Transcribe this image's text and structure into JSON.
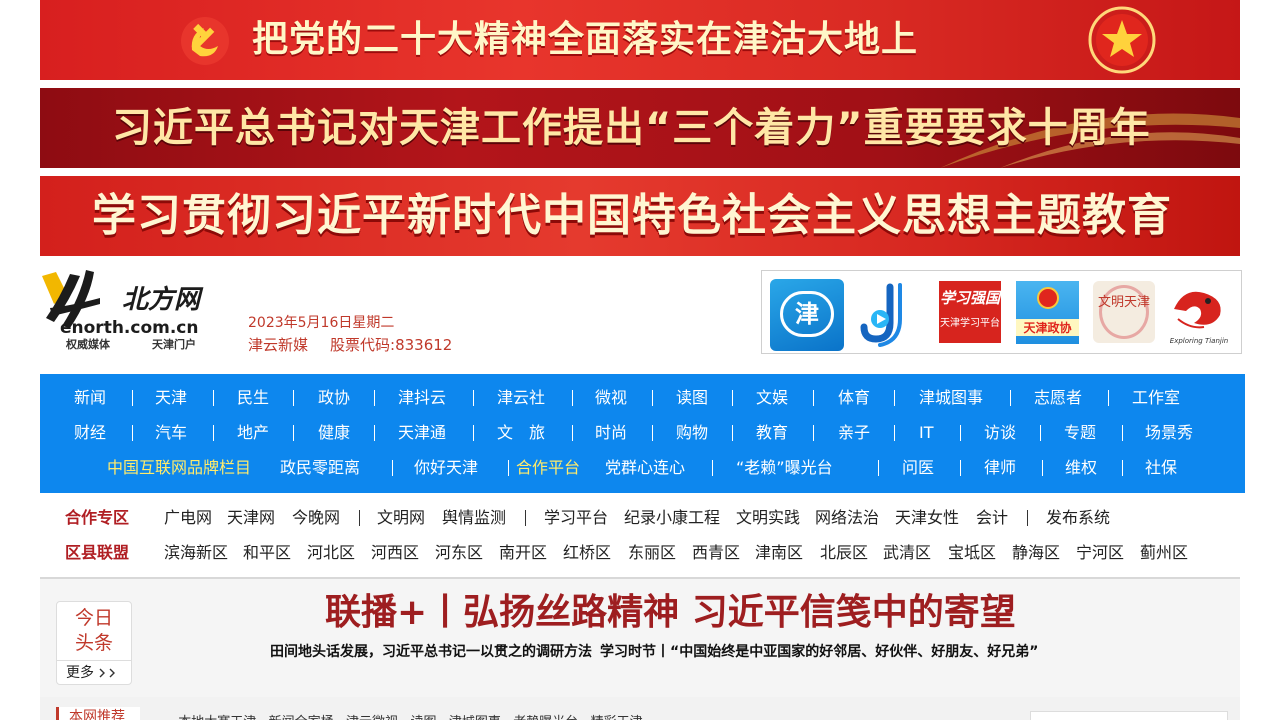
{
  "banners": [
    {
      "text": "把党的二十大精神全面落实在津沽大地上"
    },
    {
      "text": "习近平总书记对天津工作提出“三个着力”重要要求十周年"
    },
    {
      "text": "学习贯彻习近平新时代中国特色社会主义思想主题教育"
    }
  ],
  "header": {
    "logo_text": "北方网",
    "logo_domain": "enorth.com.cn",
    "logo_slogan_left": "权威媒体",
    "logo_slogan_right": "天津门户",
    "date": "2023年5月16日星期二",
    "media_name": "津云新媒",
    "stock_code": "股票代码:833612"
  },
  "apps": {
    "jin_glyph": "津",
    "xxqg_title": "学习强国",
    "xxqg_caption": "天津学习平台",
    "zhengxie_caption": "天津政协",
    "wenming_text": "文明天津",
    "explore_caption": "Exploring Tianjin"
  },
  "nav": {
    "row1": [
      "新闻",
      "天津",
      "民生",
      "政协",
      "津抖云",
      "津云社",
      "微视",
      "读图",
      "文娱",
      "体育",
      "津城图事",
      "志愿者",
      "工作室"
    ],
    "row2": [
      "财经",
      "汽车",
      "地产",
      "健康",
      "天津通",
      "文　旅",
      "时尚",
      "购物",
      "教育",
      "亲子",
      "IT",
      "访谈",
      "专题",
      "场景秀"
    ],
    "row3": [
      "中国互联网品牌栏目",
      "政民零距离",
      "你好天津",
      "合作平台",
      "党群心连心",
      "“老赖”曝光台",
      "问医",
      "律师",
      "维权",
      "社保"
    ]
  },
  "partners": {
    "title": "合作专区",
    "links": [
      "广电网",
      "天津网",
      "今晚网",
      "文明网",
      "舆情监测",
      "学习平台",
      "纪录小康工程",
      "文明实践",
      "网络法治",
      "天津女性",
      "会计",
      "发布系统"
    ]
  },
  "districts": {
    "title": "区县联盟",
    "links": [
      "滨海新区",
      "和平区",
      "河北区",
      "河西区",
      "河东区",
      "南开区",
      "红桥区",
      "东丽区",
      "西青区",
      "津南区",
      "北辰区",
      "武清区",
      "宝坻区",
      "静海区",
      "宁河区",
      "蓟州区"
    ]
  },
  "headline": {
    "today_line1": "今日",
    "today_line2": "头条",
    "more": "更多",
    "title": "联播+丨弘扬丝路精神 习近平信笺中的寄望",
    "sub1": "田间地头话发展，习近平总书记一以贯之的调研方法",
    "sub2": "学习时节丨“中国始终是中亚国家的好邻居、好伙伴、好朋友、好兄弟”"
  },
  "bottom": {
    "tab": "本网推荐",
    "links": "· 本地大赛天津 · 新闻全家桶 · 津云微视 · 读图 · 津城图事 · 老赖曝光台 · 精彩天津"
  }
}
